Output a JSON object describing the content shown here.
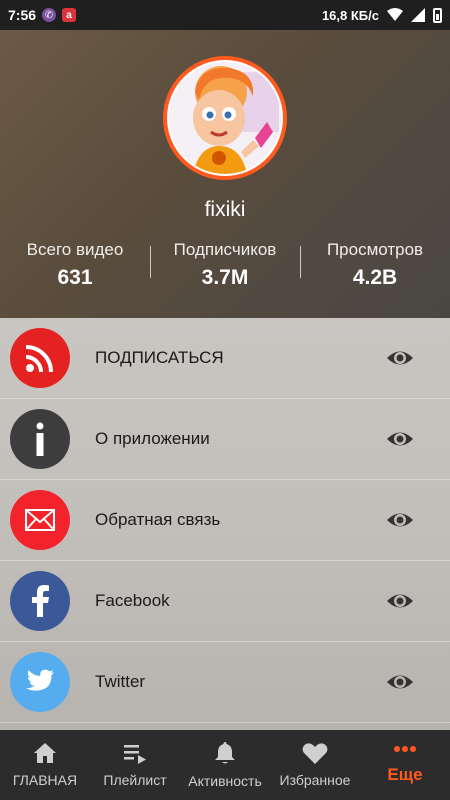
{
  "status_bar": {
    "time": "7:56",
    "network_speed": "16,8 КБ/с"
  },
  "profile": {
    "channel_name": "fixiki",
    "stats": [
      {
        "label": "Всего видео",
        "value": "631"
      },
      {
        "label": "Подписчиков",
        "value": "3.7M"
      },
      {
        "label": "Просмотров",
        "value": "4.2B"
      }
    ]
  },
  "menu": {
    "items": [
      {
        "label": "ПОДПИСАТЬСЯ",
        "icon": "rss-icon",
        "color": "#e52222"
      },
      {
        "label": "О приложении",
        "icon": "info-icon",
        "color": "#3d3d3d"
      },
      {
        "label": "Обратная связь",
        "icon": "mail-icon",
        "color": "#f2232a"
      },
      {
        "label": "Facebook",
        "icon": "facebook-icon",
        "color": "#3b5998"
      },
      {
        "label": "Twitter",
        "icon": "twitter-icon",
        "color": "#55acee"
      }
    ]
  },
  "bottom_nav": {
    "items": [
      {
        "label": "ГЛАВНАЯ",
        "icon": "home-icon"
      },
      {
        "label": "Плейлист",
        "icon": "playlist-icon"
      },
      {
        "label": "Активность",
        "icon": "bell-icon"
      },
      {
        "label": "Избранное",
        "icon": "heart-icon"
      },
      {
        "label": "Еще",
        "icon": "more-icon",
        "active": true
      }
    ]
  },
  "colors": {
    "accent": "#ff5a1f",
    "nav_background": "#2c2c2c"
  }
}
